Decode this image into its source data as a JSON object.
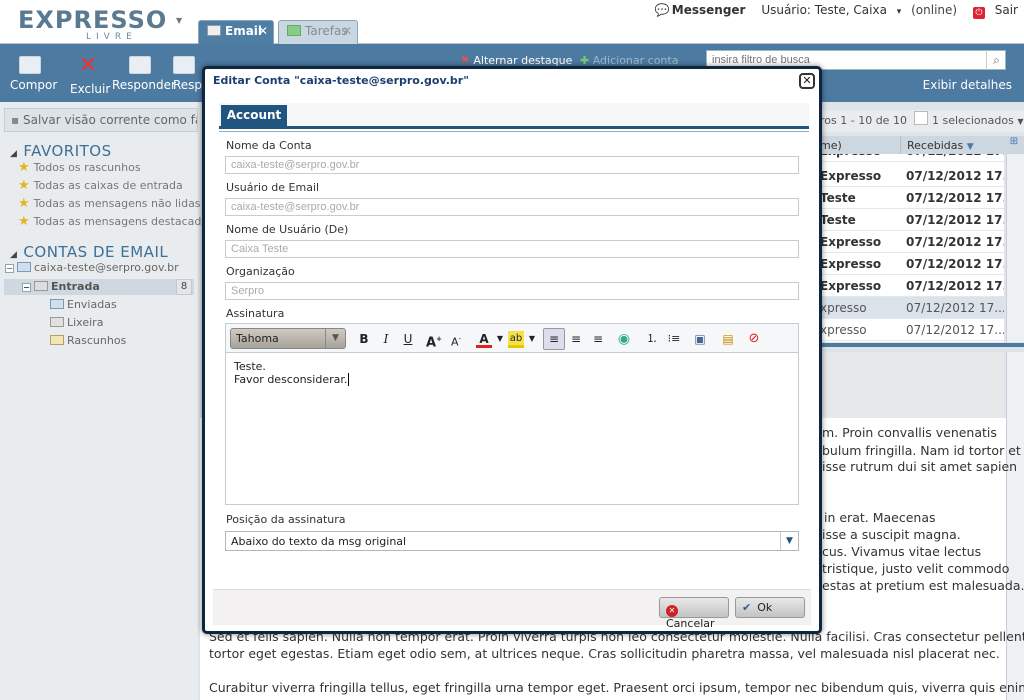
{
  "app": {
    "logo_top": "EXPRESSO",
    "logo_bottom": "LIVRE"
  },
  "tabs": [
    {
      "label": "Email"
    },
    {
      "label": "Tarefas"
    }
  ],
  "topright": {
    "messenger": "Messenger",
    "user": "Usuário: Teste, Caixa",
    "user_arrow": "▾",
    "status": "(online)",
    "logout": "Sair"
  },
  "toolbar": {
    "compor": "Compor",
    "excluir": "Excluir",
    "responder": "Responder",
    "resp2": "Resp",
    "alternar": "Alternar destaque",
    "adicionar": "Adicionar conta",
    "exibir": "Exibir detalhes"
  },
  "search": {
    "placeholder": "insira filtro de busca"
  },
  "left": {
    "save_view": "Salvar visão corrente como favorito",
    "fav_title": "FAVORITOS",
    "favorites": [
      "Todos os rascunhos",
      "Todas as caixas de entrada",
      "Todas as mensagens não lidas",
      "Todas as mensagens destacadas"
    ],
    "accounts_title": "CONTAS DE EMAIL",
    "account": "caixa-teste@serpro.gov.br",
    "inbox": "Entrada",
    "inbox_count": "8",
    "folders": [
      "Enviadas",
      "Lixeira",
      "Rascunhos"
    ]
  },
  "list": {
    "paging": "ros 1 - 10 de 10",
    "selected": "1 selecionados",
    "col_name": "me)",
    "col_date": "Recebidas",
    "rows": [
      {
        "sender": "Expresso",
        "date": "07/12/2012 17..."
      },
      {
        "sender": "Teste",
        "date": "07/12/2012 17..."
      },
      {
        "sender": "Teste",
        "date": "07/12/2012 17..."
      },
      {
        "sender": "Expresso",
        "date": "07/12/2012 17..."
      },
      {
        "sender": "Expresso",
        "date": "07/12/2012 17..."
      },
      {
        "sender": "Expresso",
        "date": "07/12/2012 17..."
      },
      {
        "sender": "xpresso",
        "date": "07/12/2012 17..."
      },
      {
        "sender": "xpresso",
        "date": "07/12/2012 17..."
      }
    ]
  },
  "preview": {
    "lines": [
      "m. Proin convallis venenatis",
      "bulum fringilla. Nam id tortor et",
      "isse rutrum dui sit amet sapien",
      "in erat. Maecenas",
      "isse a suscipit magna.",
      "cus. Vivamus vitae lectus",
      "tristique, justo velit commodo",
      "estas at pretium est malesuada.",
      "Sed et felis sapien. Nulla non tempor erat. Proin viverra turpis non leo consectetur molestie. Nulla facilisi. Cras consectetur pellentesque",
      "tortor eget egestas. Etiam eget odio sem, at ultrices neque. Cras sollicitudin pharetra massa, vel malesuada nisl placerat nec.",
      "Curabitur viverra fringilla tellus, eget fringilla urna tempor eget. Praesent orci ipsum, tempor nec bibendum quis, viverra quis enim."
    ]
  },
  "modal": {
    "title": "Editar Conta \"caixa-teste@serpro.gov.br\"",
    "tab": "Account",
    "fields": [
      {
        "label": "Nome da Conta",
        "value": "caixa-teste@serpro.gov.br"
      },
      {
        "label": "Usuário de Email",
        "value": "caixa-teste@serpro.gov.br"
      },
      {
        "label": "Nome de Usuário (De)",
        "value": "Caixa Teste"
      },
      {
        "label": "Organização",
        "value": "Serpro"
      }
    ],
    "signature_label": "Assinatura",
    "font": "Tahoma",
    "signature_lines": [
      "Teste.",
      "Favor desconsiderar."
    ],
    "position_label": "Posição da assinatura",
    "position_value": "Abaixo do texto da msg original",
    "cancel": "Cancelar",
    "ok": "Ok"
  }
}
